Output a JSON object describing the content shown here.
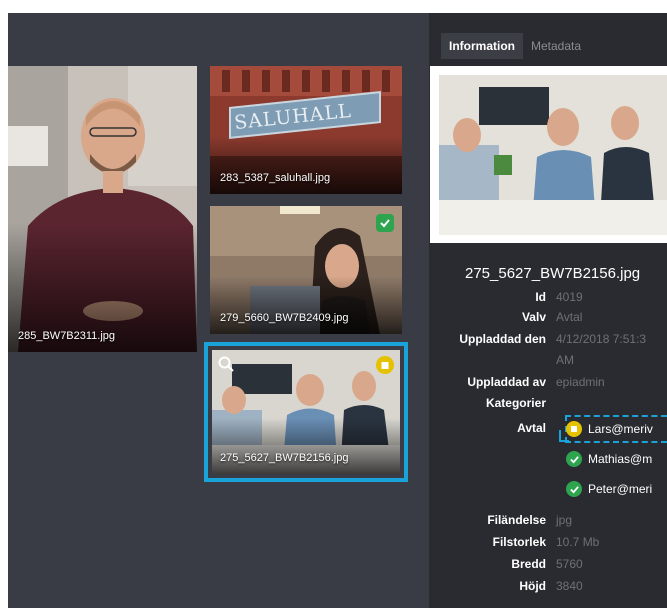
{
  "gallery": {
    "tiles": [
      {
        "caption": "285_BW7B2311.jpg"
      },
      {
        "caption": "283_5387_saluhall.jpg",
        "sign_text": "SALUHALL"
      },
      {
        "caption": "279_5660_BW7B2409.jpg"
      },
      {
        "caption": "275_5627_BW7B2156.jpg"
      }
    ]
  },
  "panel": {
    "tabs": [
      {
        "label": "Information"
      },
      {
        "label": "Metadata"
      }
    ],
    "title": "275_5627_BW7B2156.jpg",
    "fields": {
      "id_label": "Id",
      "id_value": "4019",
      "valv_label": "Valv",
      "valv_value": "Avtal",
      "uploaded_label": "Uppladdad den",
      "uploaded_value_1": "4/12/2018 7:51:3",
      "uploaded_value_2": "AM",
      "uploader_label": "Uppladdad av",
      "uploader_value": "epiadmin",
      "kategorier_label": "Kategorier",
      "avtal_label": "Avtal",
      "avtal_items": [
        {
          "text": "Lars@meriv",
          "status": "pending"
        },
        {
          "text": "Mathias@m",
          "status": "approved"
        },
        {
          "text": "Peter@meri",
          "status": "approved"
        }
      ],
      "ext_label": "Filändelse",
      "ext_value": "jpg",
      "size_label": "Filstorlek",
      "size_value": "10.7 Mb",
      "width_label": "Bredd",
      "width_value": "5760",
      "height_label": "Höjd",
      "height_value": "3840"
    }
  },
  "colors": {
    "gallery_bg": "#3a3c45",
    "panel_bg": "#2a2b30",
    "selection": "#1aa3d9",
    "approved": "#2ea44f",
    "pending": "#e5c100"
  }
}
